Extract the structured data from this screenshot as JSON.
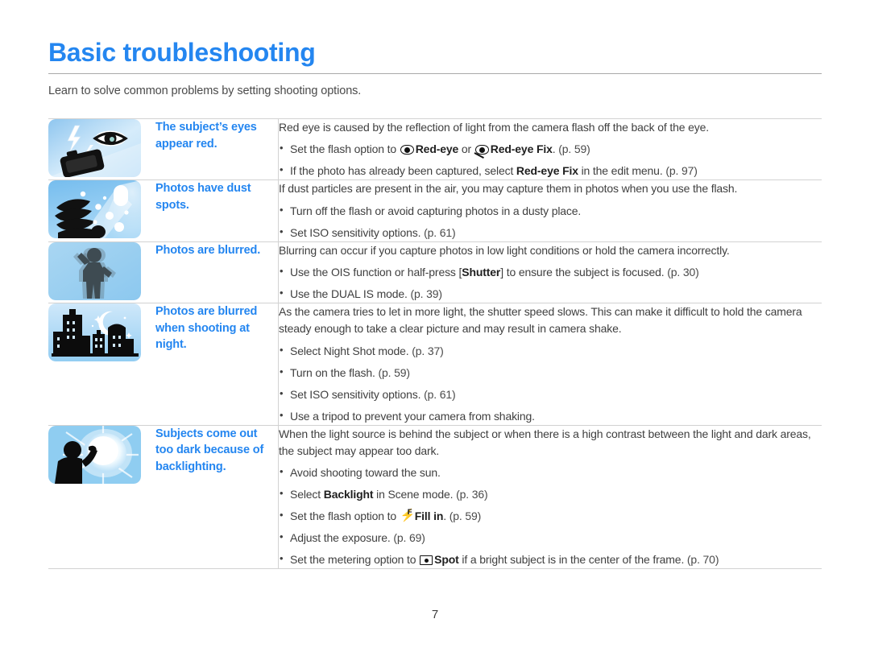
{
  "header": {
    "title": "Basic troubleshooting",
    "subtitle": "Learn to solve common problems by setting shooting options.",
    "title_color": "#2486f0",
    "rule_color": "#a9a9a9"
  },
  "page_number": "7",
  "table": {
    "rows": [
      {
        "icon_name": "camera-flash-red-eye-illustration",
        "label": "The subject’s eyes appear red.",
        "lead": "Red eye is caused by the reflection of light from the camera flash off the back of the eye.",
        "bullets": [
          {
            "parts": [
              {
                "type": "text",
                "text": "Set the flash option to "
              },
              {
                "type": "icon",
                "icon": "red-eye-icon"
              },
              {
                "type": "bold",
                "text": "Red-eye"
              },
              {
                "type": "text",
                "text": " or "
              },
              {
                "type": "icon",
                "icon": "red-eye-fix-icon"
              },
              {
                "type": "bold",
                "text": "Red-eye Fix"
              },
              {
                "type": "text",
                "text": ". "
              },
              {
                "type": "page",
                "text": "(p. 59)"
              }
            ]
          },
          {
            "parts": [
              {
                "type": "text",
                "text": "If the photo has already been captured, select "
              },
              {
                "type": "bold",
                "text": "Red-eye Fix"
              },
              {
                "type": "text",
                "text": " in the edit menu. "
              },
              {
                "type": "page",
                "text": "(p. 97)"
              }
            ]
          }
        ]
      },
      {
        "icon_name": "dust-spots-illustration",
        "label": "Photos have dust spots.",
        "lead": "If dust particles are present in the air, you may capture them in photos when you use the flash.",
        "bullets": [
          {
            "parts": [
              {
                "type": "text",
                "text": "Turn off the flash or avoid capturing photos in a dusty place."
              }
            ]
          },
          {
            "parts": [
              {
                "type": "text",
                "text": "Set ISO sensitivity options. "
              },
              {
                "type": "page",
                "text": "(p. 61)"
              }
            ]
          }
        ]
      },
      {
        "icon_name": "blurred-person-illustration",
        "label": "Photos are blurred.",
        "lead": "Blurring can occur if you capture photos in low light conditions or hold the camera incorrectly.",
        "bullets": [
          {
            "parts": [
              {
                "type": "text",
                "text": "Use the OIS function or half-press ["
              },
              {
                "type": "bold",
                "text": "Shutter"
              },
              {
                "type": "text",
                "text": "] to ensure the subject is focused. "
              },
              {
                "type": "page",
                "text": "(p. 30)"
              }
            ]
          },
          {
            "parts": [
              {
                "type": "text",
                "text": "Use the DUAL IS mode. "
              },
              {
                "type": "page",
                "text": "(p. 39)"
              }
            ]
          }
        ]
      },
      {
        "icon_name": "night-city-illustration",
        "label": "Photos are blurred when shooting at night.",
        "lead": "As the camera tries to let in more light, the shutter speed slows. This can make it difficult to hold the camera steady enough to take a clear picture and may result in camera shake.",
        "bullets": [
          {
            "parts": [
              {
                "type": "text",
                "text": "Select Night Shot mode. "
              },
              {
                "type": "page",
                "text": "(p. 37)"
              }
            ]
          },
          {
            "parts": [
              {
                "type": "text",
                "text": "Turn on the flash. "
              },
              {
                "type": "page",
                "text": "(p. 59)"
              }
            ]
          },
          {
            "parts": [
              {
                "type": "text",
                "text": "Set ISO sensitivity options. "
              },
              {
                "type": "page",
                "text": "(p. 61)"
              }
            ]
          },
          {
            "parts": [
              {
                "type": "text",
                "text": "Use a tripod to prevent your camera from shaking."
              }
            ]
          }
        ]
      },
      {
        "icon_name": "backlight-sun-illustration",
        "label": "Subjects come out too dark because of backlighting.",
        "lead": "When the light source is behind the subject or when there is a high contrast between the light and dark areas, the subject may appear too dark.",
        "bullets": [
          {
            "parts": [
              {
                "type": "text",
                "text": "Avoid shooting toward the sun."
              }
            ]
          },
          {
            "parts": [
              {
                "type": "text",
                "text": "Select "
              },
              {
                "type": "bold",
                "text": "Backlight"
              },
              {
                "type": "text",
                "text": " in Scene mode. "
              },
              {
                "type": "page",
                "text": "(p. 36)"
              }
            ]
          },
          {
            "parts": [
              {
                "type": "text",
                "text": "Set the flash option to "
              },
              {
                "type": "icon",
                "icon": "fill-in-flash-icon"
              },
              {
                "type": "bold",
                "text": "Fill in"
              },
              {
                "type": "text",
                "text": ". "
              },
              {
                "type": "page",
                "text": "(p. 59)"
              }
            ]
          },
          {
            "parts": [
              {
                "type": "text",
                "text": "Adjust the exposure. "
              },
              {
                "type": "page",
                "text": "(p. 69)"
              }
            ]
          },
          {
            "parts": [
              {
                "type": "text",
                "text": "Set the metering option to "
              },
              {
                "type": "icon",
                "icon": "spot-metering-icon"
              },
              {
                "type": "bold",
                "text": "Spot"
              },
              {
                "type": "text",
                "text": " if a bright subject is in the center of the frame. "
              },
              {
                "type": "page",
                "text": "(p. 70)"
              }
            ]
          }
        ]
      }
    ]
  }
}
